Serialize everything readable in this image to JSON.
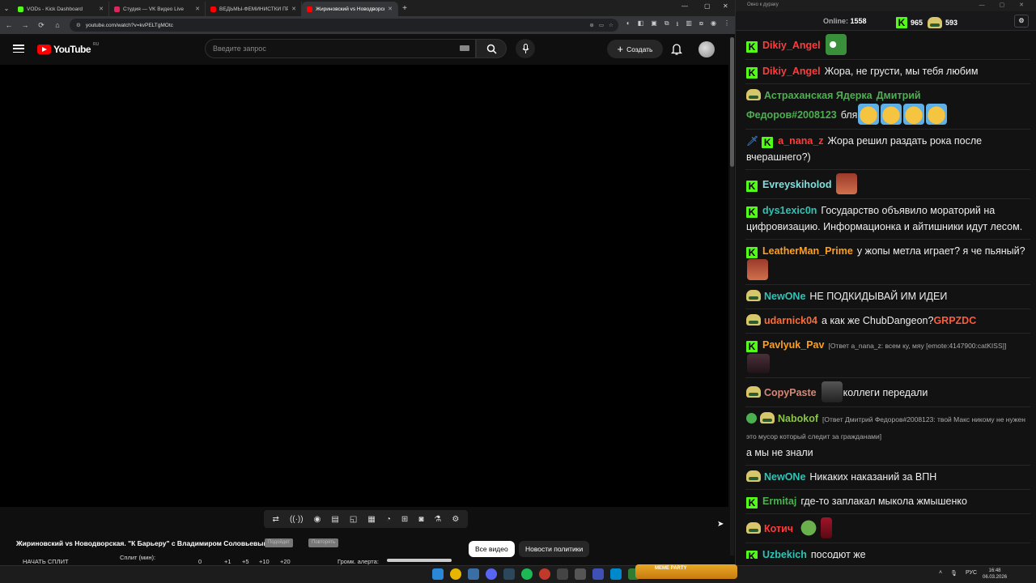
{
  "browser": {
    "tabs": [
      {
        "title": "VODs - Kick Dashboard",
        "fav": "#53fc18"
      },
      {
        "title": "Студия — VK Видео Live",
        "fav": "#e0245e"
      },
      {
        "title": "ВЕДЬМЫ-ФЕМИНИСТКИ ПРОТ",
        "fav": "#ff0000"
      },
      {
        "title": "Жириновский vs Новодворская",
        "fav": "#ff0000",
        "active": true
      }
    ],
    "url": "youtube.com/watch?v=kvPELTgMOtc"
  },
  "youtube": {
    "logo": "YouTube",
    "country": "RU",
    "search_placeholder": "Введите запрос",
    "create": "Создать",
    "video_title": "Жириновский vs Новодворская. \"К Барьеру\" с Владимиром Соловьевым",
    "tag1": "Подойдет",
    "tag2": "Повторять",
    "chip_all": "Все видео",
    "chip_news": "Новости политики",
    "split_button": "НАЧАТЬ СПЛИТ",
    "split_label": "Сплит (мин):",
    "split_vals": [
      "0",
      "+1",
      "+5",
      "+10",
      "+20"
    ],
    "alert_label": "Громк. алерта:"
  },
  "chat": {
    "window_title": "Окно к дураку",
    "online_label": "Online:",
    "online": "1558",
    "kick_count": "965",
    "yt_count": "593",
    "messages": [
      {
        "badges": [
          "kick"
        ],
        "user": "Dikiy_Angel",
        "color": "#ff3b3b",
        "text": "",
        "emotes": [
          "glass"
        ]
      },
      {
        "badges": [
          "kick"
        ],
        "user": "Dikiy_Angel",
        "color": "#ff3b3b",
        "text": "Жора, не грусти, мы тебя любим",
        "emotes": []
      },
      {
        "badges": [
          "pepe"
        ],
        "user": "Астраханская Ядерка",
        "color": "#4caf50",
        "text": "",
        "mention": "Дмитрий Федоров#2008123",
        "after": "бля",
        "emotes": [
          "laugh",
          "laugh",
          "laugh",
          "laugh"
        ]
      },
      {
        "badges": [
          "sword",
          "kick"
        ],
        "user": "a_nana_z",
        "color": "#ff3b3b",
        "text": "Жора решил раздать рока после вчерашнего?)",
        "emotes": []
      },
      {
        "badges": [
          "kick"
        ],
        "user": "Evreyskiholod",
        "color": "#7fe0e0",
        "text": "",
        "emotes": [
          "face"
        ]
      },
      {
        "badges": [
          "kick"
        ],
        "user": "dys1exic0n",
        "color": "#2ec4b6",
        "text": "Государство объявило мораторий на цифровизацию. Информационка и айтишники идут лесом.",
        "emotes": []
      },
      {
        "badges": [
          "kick"
        ],
        "user": "LeatherMan_Prime",
        "color": "#ff9f1c",
        "text": "у жопы метла играет? я че пьяный?",
        "emotes": [
          "face"
        ]
      },
      {
        "badges": [
          "pepe"
        ],
        "user": "NewONe",
        "color": "#2ec4b6",
        "text": "НЕ ПОДКИДЫВАЙ ИМ ИДЕИ",
        "emotes": []
      },
      {
        "badges": [
          "pepe"
        ],
        "user": "udarnick04",
        "color": "#ff6b35",
        "text": "а как же ChubDangeon?",
        "tail": "GRPZDC",
        "emotes": []
      },
      {
        "badges": [
          "kick"
        ],
        "user": "Pavlyuk_Pav",
        "color": "#ff9f1c",
        "reply": "[Ответ a_nana_z: всем ку, мяу [emote:4147900:catKISS]]",
        "text": "",
        "emotes": [
          "cat"
        ]
      },
      {
        "badges": [
          "pepe"
        ],
        "user": "CopyPaste",
        "color": "#d4897a",
        "text": "коллеги передали",
        "emotes_before": [
          "man"
        ],
        "emotes": []
      },
      {
        "badges": [
          "shield",
          "pepe"
        ],
        "user": "Nabokof",
        "color": "#8bc34a",
        "reply": "[Ответ Дмитрий Федоров#2008123: твой Макс никому не нужен это мусор который следит за гражданами]",
        "text": "а мы не знали",
        "emotes": []
      },
      {
        "badges": [
          "pepe"
        ],
        "user": "NewONe",
        "color": "#2ec4b6",
        "text": "Никаких наказаний за ВПН",
        "emotes": []
      },
      {
        "badges": [
          "kick"
        ],
        "user": "Ermitaj",
        "color": "#4caf50",
        "text": "где-то заплакал мыкола жмышенко",
        "emotes": []
      },
      {
        "badges": [
          "pepe"
        ],
        "user": "Котич",
        "color": "#ff3b3b",
        "text": "",
        "emotes": [
          "frog",
          "wine"
        ]
      },
      {
        "badges": [
          "kick"
        ],
        "user": "Uzbekich",
        "color": "#2ec4b6",
        "text": "посодют же",
        "emotes": []
      }
    ]
  },
  "taskbar": {
    "meme": "MEME PARTY",
    "lang": "РУС",
    "time": "16:48",
    "date": "06.03.2026"
  }
}
